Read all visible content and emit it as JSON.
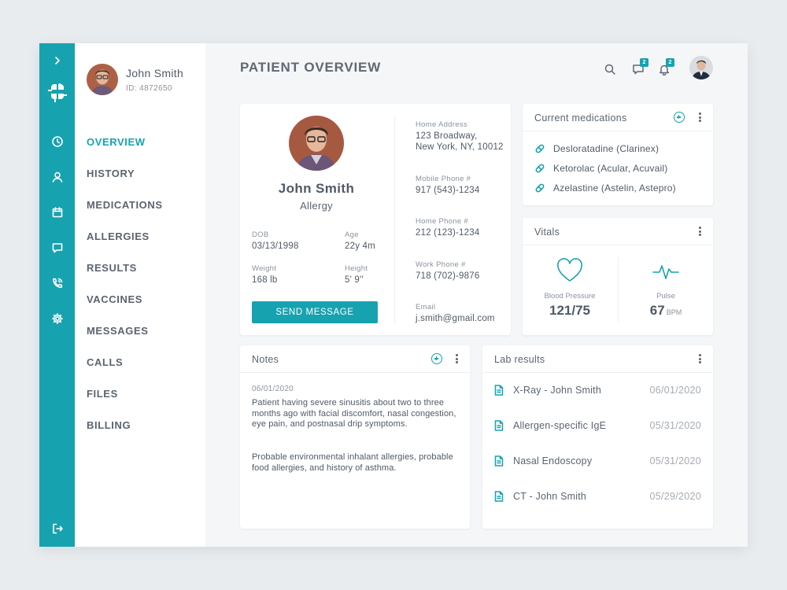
{
  "app": {
    "page_title": "PATIENT OVERVIEW",
    "accent_color": "#17a2b0"
  },
  "rail": {
    "icons": [
      "chevron-right-icon",
      "logo-icon",
      "clock-icon",
      "user-icon",
      "calendar-icon",
      "chat-icon",
      "phone-icon",
      "gear-icon",
      "logout-icon"
    ]
  },
  "sidebar": {
    "user_name": "John Smith",
    "user_id": "ID: 4872650",
    "items": [
      {
        "label": "OVERVIEW",
        "active": true
      },
      {
        "label": "HISTORY"
      },
      {
        "label": "MEDICATIONS"
      },
      {
        "label": "ALLERGIES"
      },
      {
        "label": "RESULTS"
      },
      {
        "label": "VACCINES"
      },
      {
        "label": "MESSAGES"
      },
      {
        "label": "CALLS"
      },
      {
        "label": "FILES"
      },
      {
        "label": "BILLING"
      }
    ]
  },
  "header": {
    "messages_badge": "2",
    "notifications_badge": "2"
  },
  "patient": {
    "name": "John Smith",
    "condition": "Allergy",
    "dob_label": "DOB",
    "dob": "03/13/1998",
    "age_label": "Age",
    "age": "22y 4m",
    "weight_label": "Weight",
    "weight": "168 lb",
    "height_label": "Height",
    "height": "5' 9''",
    "send_button": "SEND MESSAGE",
    "address_label": "Home Address",
    "address_line1": "123 Broadway,",
    "address_line2": "New York, NY, 10012",
    "mobile_label": "Mobile Phone #",
    "mobile": "917 (543)-1234",
    "home_phone_label": "Home Phone #",
    "home_phone": "212 (123)-1234",
    "work_phone_label": "Work Phone #",
    "work_phone": "718 (702)-9876",
    "email_label": "Email",
    "email": "j.smith@gmail.com"
  },
  "medications": {
    "title": "Current medications",
    "items": [
      "Desloratadine (Clarinex)",
      "Ketorolac (Acular, Acuvail)",
      "Azelastine (Astelin, Astepro)"
    ]
  },
  "vitals": {
    "title": "Vitals",
    "bp_label": "Blood Pressure",
    "bp_value": "121/75",
    "pulse_label": "Pulse",
    "pulse_value": "67",
    "pulse_unit": "BPM"
  },
  "notes": {
    "title": "Notes",
    "date": "06/01/2020",
    "paragraph1": "Patient having severe sinusitis about two to three months ago with facial discomfort, nasal congestion, eye pain, and postnasal drip symptoms.",
    "paragraph2": "Probable environmental inhalant allergies, probable food allergies, and history of asthma."
  },
  "lab_results": {
    "title": "Lab results",
    "items": [
      {
        "name": "X-Ray - John Smith",
        "date": "06/01/2020"
      },
      {
        "name": "Allergen-specific IgE",
        "date": "05/31/2020"
      },
      {
        "name": "Nasal Endoscopy",
        "date": "05/31/2020"
      },
      {
        "name": "CT - John Smith",
        "date": "05/29/2020"
      }
    ]
  }
}
